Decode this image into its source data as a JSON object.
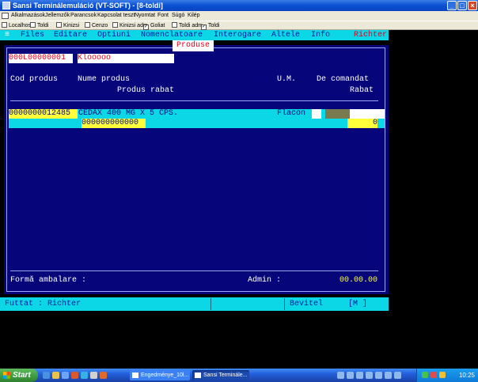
{
  "window": {
    "title": "Sansi Terminálemuláció (VT-SOFT) - [8-toldi]",
    "buttons": {
      "minimize": "_",
      "maximize": "□",
      "close": "×"
    }
  },
  "app_menu": [
    "Alkalmazások",
    "Jellemzők",
    "Parancsok",
    "Kapcsolat teszt",
    "Nyomtat",
    "Font",
    "Súgó",
    "Kilép"
  ],
  "toolbar": {
    "items": [
      {
        "label": "Localhost",
        "checked": false
      },
      {
        "label": "Toldi",
        "checked": false
      },
      {
        "label": "Kinizsi",
        "checked": false
      },
      {
        "label": "Cenzo",
        "checked": false
      },
      {
        "label": "Kinizsi adm",
        "checked": false
      },
      {
        "label": "Goliat",
        "checked": true
      },
      {
        "label": "Toldi adm",
        "checked": false
      },
      {
        "label": "Toldi",
        "checked": true
      }
    ]
  },
  "terminal": {
    "menu": {
      "system": "≡",
      "files": "Files",
      "editare": "Editare",
      "optiuni": "Optiuni",
      "nomenclatoare": "Nomenclatoare",
      "interogare": "Interogare",
      "altele": "Altele",
      "info": "Info",
      "user": "Richter"
    },
    "panel_title": "Produse",
    "header": {
      "code": "000L00000001",
      "name": "Klooooo"
    },
    "columns": {
      "cod_produs": "Cod produs",
      "nume_produs": "Nume produs",
      "um": "U.M.",
      "de_comandat": "De comandat",
      "produs_rabat": "Produs rabat",
      "rabat": "Rabat"
    },
    "row": {
      "cod": "0000000012485",
      "nume": "CEDAX 400 MG X 5 CPS.",
      "um": "Flacon",
      "rabat_cod": "000000000000",
      "rabat_value": "0"
    },
    "footer": {
      "forma_label": "Formă ambalare :",
      "admin_label": "Admin :",
      "date": "00.00.00"
    },
    "status": {
      "user": "Futtat  : Richter",
      "mode": "Bevitel",
      "mode_code": "[M   ]"
    }
  },
  "taskbar": {
    "start": "Start",
    "tasks": [
      "Engedménye_10l...",
      "Sansi Terminále..."
    ],
    "clock": "10:25"
  }
}
